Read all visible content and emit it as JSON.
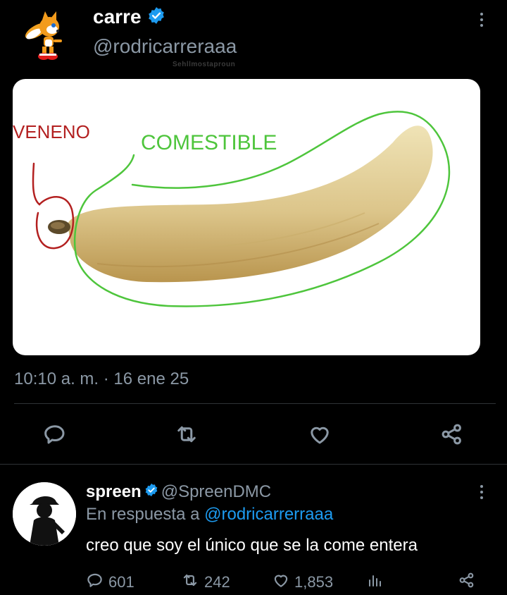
{
  "tweet": {
    "author": {
      "name": "carre",
      "handle": "@rodricarreraaa",
      "verified": true,
      "avatar_icon": "fox-character-icon"
    },
    "watermark": "Sehllmostaproun",
    "media": {
      "label_poison": "VENENO",
      "label_edible": "COMESTIBLE",
      "poison_color": "#b32020",
      "edible_color": "#4ec53c"
    },
    "timestamp": "10:10 a. m. · 16 ene 25",
    "actions": {
      "reply": "reply-icon",
      "retweet": "retweet-icon",
      "like": "like-icon",
      "share": "share-icon"
    }
  },
  "reply": {
    "author": {
      "name": "spreen",
      "handle": "@SpreenDMC",
      "verified": true,
      "avatar_icon": "silhouette-avatar-icon"
    },
    "replying_prefix": "En respuesta a",
    "replying_to": "@rodricarrerraaa",
    "text": "creo que soy el único que se la come entera",
    "stats": {
      "replies": "601",
      "retweets": "242",
      "likes": "1,853"
    }
  },
  "colors": {
    "background": "#000000",
    "text": "#e7e9ea",
    "muted": "#8b98a5",
    "accent": "#1d9bf0",
    "divider": "#2f3336"
  }
}
